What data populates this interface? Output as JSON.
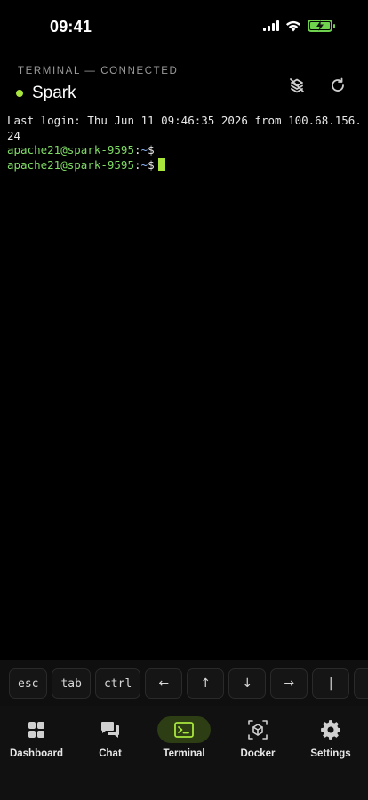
{
  "status_bar": {
    "time": "09:41"
  },
  "header": {
    "subtitle": "TERMINAL — CONNECTED",
    "title": "Spark",
    "status_color": "#a8e63e",
    "actions": [
      "disconnect-icon",
      "refresh-icon"
    ]
  },
  "terminal": {
    "login_line": "Last login: Thu Jun 11 09:46:35 2026 from 100.68.156.24",
    "prompts": [
      {
        "user": "apache21@spark-9595",
        "sep": ":",
        "path": "~",
        "symbol": "$"
      },
      {
        "user": "apache21@spark-9595",
        "sep": ":",
        "path": "~",
        "symbol": "$"
      }
    ]
  },
  "key_bar": {
    "keys": [
      "esc",
      "tab",
      "ctrl",
      "←",
      "↑",
      "↓",
      "→",
      "|"
    ]
  },
  "tab_bar": {
    "tabs": [
      {
        "label": "Dashboard",
        "icon": "grid-icon"
      },
      {
        "label": "Chat",
        "icon": "chat-icon"
      },
      {
        "label": "Terminal",
        "icon": "terminal-icon",
        "active": true
      },
      {
        "label": "Docker",
        "icon": "cube-icon"
      },
      {
        "label": "Settings",
        "icon": "gear-icon"
      }
    ]
  },
  "colors": {
    "accent": "#a8e63e",
    "prompt_user": "#7fdc65",
    "prompt_path": "#8ab4f8"
  }
}
